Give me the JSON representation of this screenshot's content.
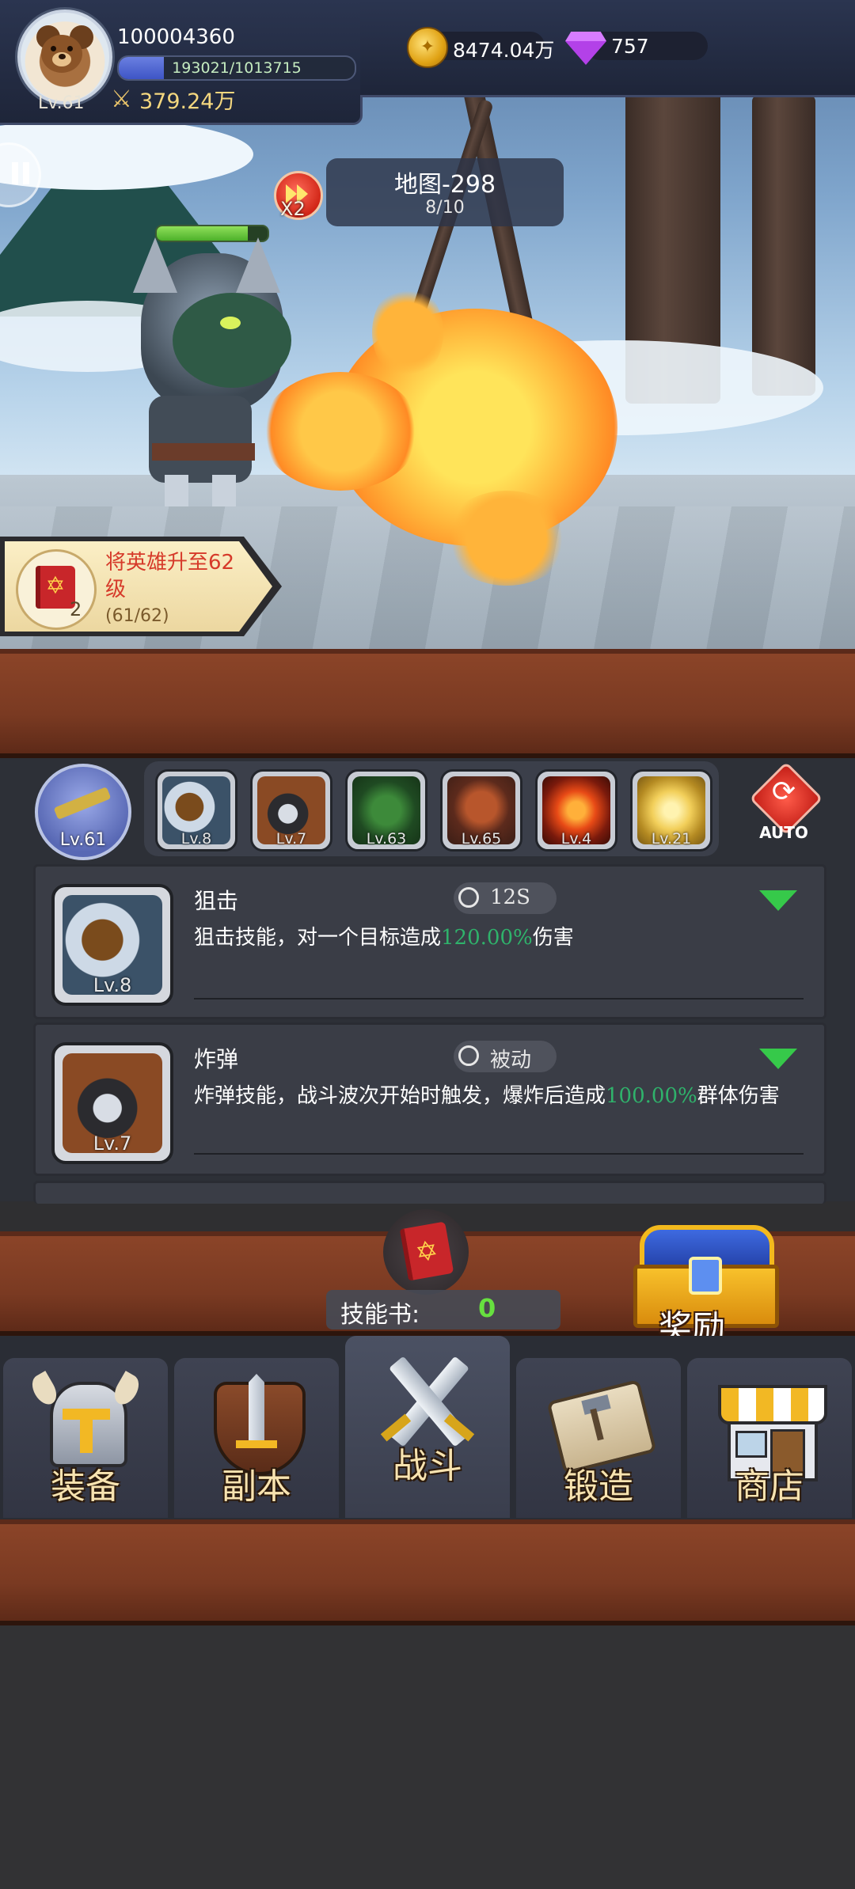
{
  "player": {
    "level": "Lv.61",
    "id": "100004360",
    "exp_text": "193021/1013715",
    "exp_fraction": 0.19,
    "power": "379.24万"
  },
  "resources": {
    "gold": "8474.04万",
    "gems": "757"
  },
  "battle": {
    "map_title": "地图-298",
    "wave": "8/10",
    "speed": "X2"
  },
  "quest": {
    "title": "将英雄升至62级",
    "count": "2",
    "progress": "(61/62)"
  },
  "hero": {
    "level": "Lv.61"
  },
  "skill_slots": [
    {
      "level": "Lv.8",
      "icon": "sniper-icon"
    },
    {
      "level": "Lv.7",
      "icon": "bomb-icon"
    },
    {
      "level": "Lv.63",
      "icon": "poison-icon"
    },
    {
      "level": "Lv.65",
      "icon": "bear-icon"
    },
    {
      "level": "Lv.4",
      "icon": "fireball-icon"
    },
    {
      "level": "Lv.21",
      "icon": "lightning-icon"
    }
  ],
  "auto_label": "AUTO",
  "skills": [
    {
      "name": "狙击",
      "cooldown": "12S",
      "level": "Lv.8",
      "desc_pre": "狙击技能，对一个目标造成",
      "desc_value": "120.00%",
      "desc_post": "伤害"
    },
    {
      "name": "炸弹",
      "cooldown": "被动",
      "level": "Lv.7",
      "desc_pre": "炸弹技能，战斗波次开始时触发，爆炸后造成",
      "desc_value": "100.00%",
      "desc_post": "群体伤害"
    }
  ],
  "skill_book": {
    "label": "技能书:",
    "value": "0"
  },
  "reward_label": "奖励",
  "nav": {
    "equip": "装备",
    "dungeon": "副本",
    "battle": "战斗",
    "forge": "锻造",
    "shop": "商店"
  },
  "colors": {
    "highlight_green": "#2fb26b",
    "skill_book_value": "#67e03f",
    "quest_title": "#d63a2a"
  }
}
